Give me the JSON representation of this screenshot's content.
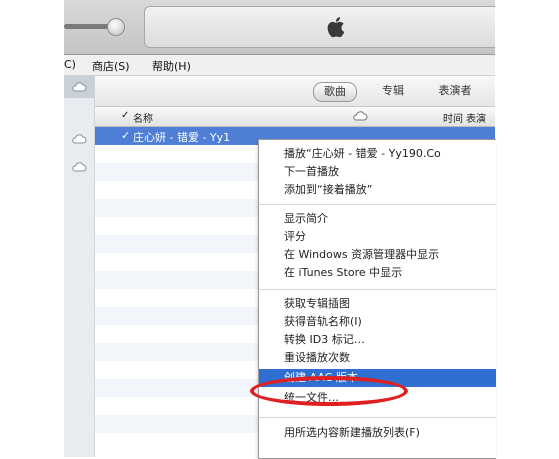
{
  "menubar": {
    "partial_left": "C)",
    "store": "商店(S)",
    "help": "帮助(H)"
  },
  "viewbar": {
    "songs": "歌曲",
    "albums": "专辑",
    "artists": "表演者"
  },
  "columns": {
    "check": "✓",
    "name": "名称",
    "time": "时间",
    "artist": "表演者"
  },
  "selected_row": {
    "check": "✓",
    "title": "庄心妍 - 错爱 - Yy1"
  },
  "context_menu": {
    "group1": [
      "播放“庄心妍 - 错爱 - Yy190.Co",
      "下一首播放",
      "添加到“接着播放”"
    ],
    "group2": [
      "显示简介",
      "评分",
      "在 Windows 资源管理器中显示",
      "在 iTunes Store 中显示"
    ],
    "group3": [
      "获取专辑插图",
      "获得音轨名称(I)",
      "转换 ID3 标记…",
      "重设播放次数",
      "创建 AAC 版本",
      "统一文件…"
    ],
    "group4": [
      "用所选内容新建播放列表(F)"
    ],
    "highlighted_item": "创建 AAC 版本"
  },
  "colors": {
    "selection": "#4f7ed6",
    "menu_highlight": "#2f6fd1",
    "annotation_ring": "#e02020"
  },
  "icons": [
    "volume-knob-icon",
    "apple-logo-icon",
    "cloud-icon",
    "cloud-icon",
    "cloud-icon"
  ]
}
